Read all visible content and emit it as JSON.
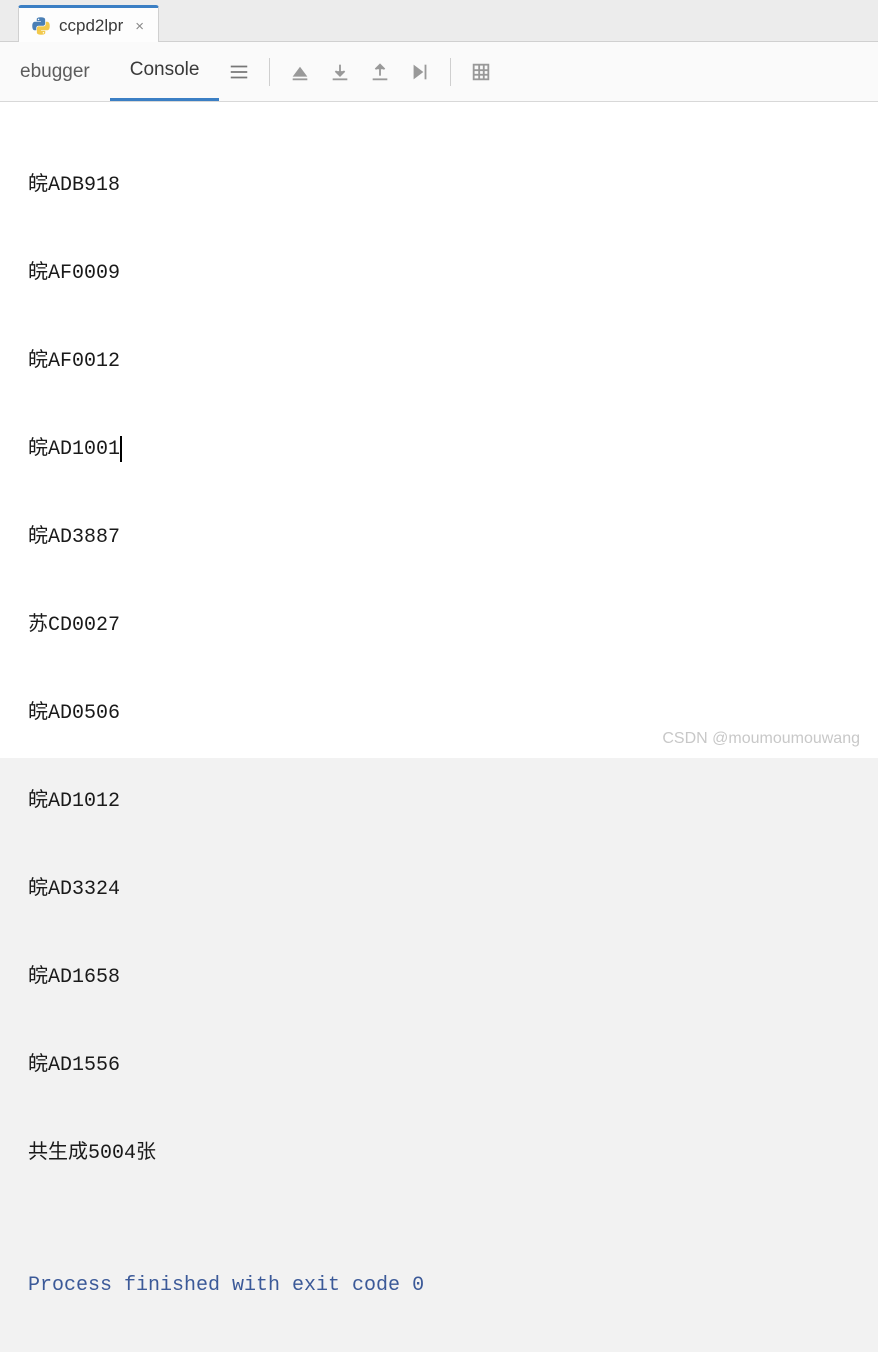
{
  "tab": {
    "title": "ccpd2lpr",
    "close": "×"
  },
  "toolbar": {
    "debugger_label": "ebugger",
    "console_label": "Console"
  },
  "console": {
    "lines": [
      "皖ADB918",
      "皖AF0009",
      "皖AF0012",
      "皖AD1001",
      "皖AD3887",
      "苏CD0027",
      "皖AD0506",
      "皖AD1012",
      "皖AD3324",
      "皖AD1658",
      "皖AD1556",
      "共生成5004张"
    ],
    "cursor_line_index": 3,
    "exit_message": "Process finished with exit code 0"
  },
  "watermark": "CSDN @moumoumouwang"
}
